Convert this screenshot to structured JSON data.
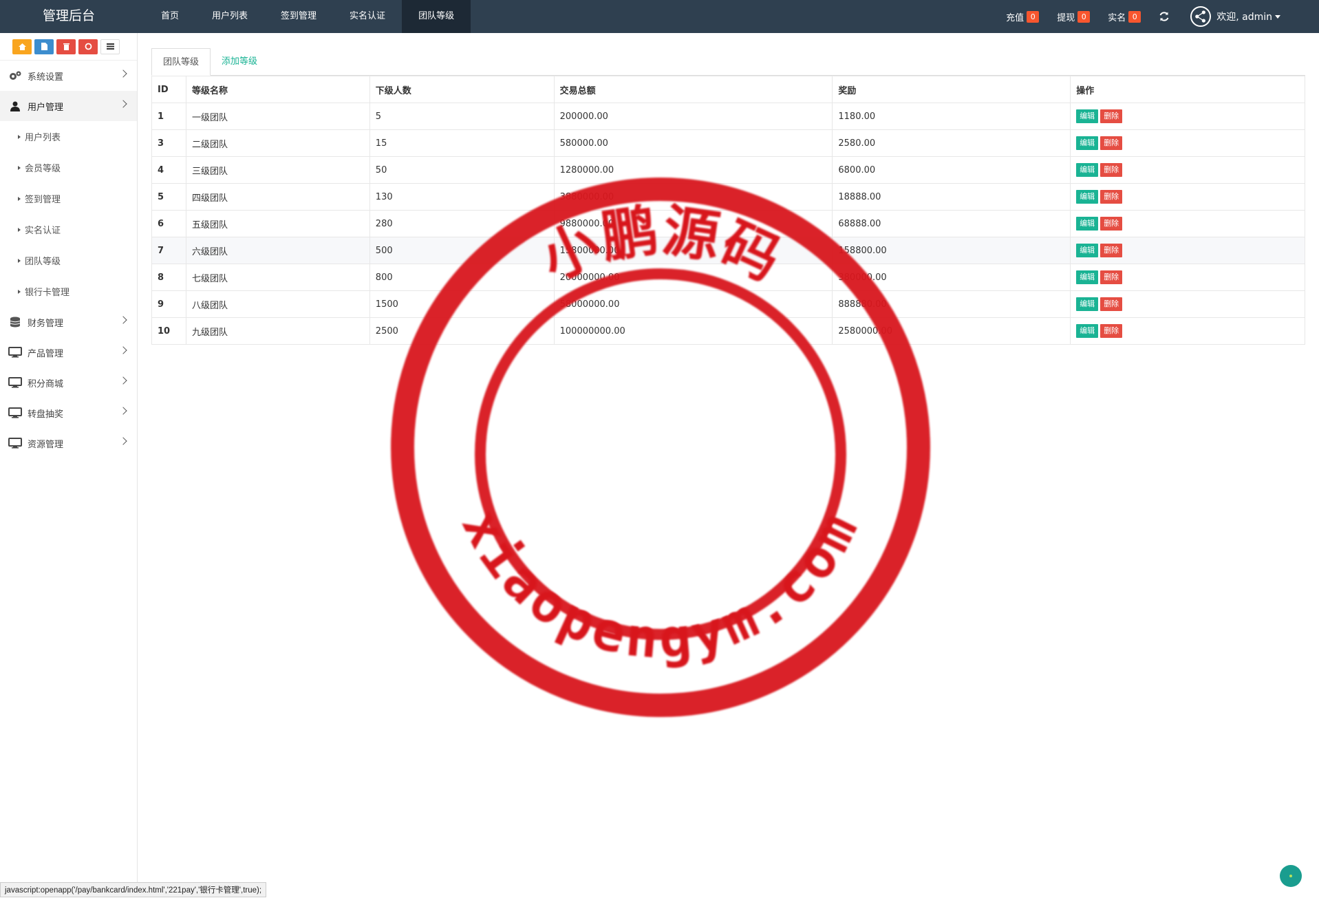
{
  "brand": "管理后台",
  "topnav": [
    "首页",
    "用户列表",
    "签到管理",
    "实名认证",
    "团队等级"
  ],
  "topright": {
    "recharge_label": "充值",
    "recharge_count": "0",
    "withdraw_label": "提现",
    "withdraw_count": "0",
    "realname_label": "实名",
    "realname_count": "0",
    "welcome": "欢迎, admin"
  },
  "sidebar": {
    "menu_system": "系统设置",
    "menu_user": "用户管理",
    "sub_items": [
      "用户列表",
      "会员等级",
      "签到管理",
      "实名认证",
      "团队等级",
      "银行卡管理"
    ],
    "menu_finance": "财务管理",
    "menu_product": "产品管理",
    "menu_points": "积分商城",
    "menu_lottery": "转盘抽奖",
    "menu_resource": "资源管理"
  },
  "tabs": [
    "团队等级",
    "添加等级"
  ],
  "table": {
    "headers": [
      "ID",
      "等级名称",
      "下级人数",
      "交易总额",
      "奖励",
      "操作"
    ],
    "edit_label": "编辑",
    "delete_label": "删除",
    "rows": [
      {
        "id": "1",
        "name": "一级团队",
        "count": "5",
        "total": "200000.00",
        "reward": "1180.00"
      },
      {
        "id": "3",
        "name": "二级团队",
        "count": "15",
        "total": "580000.00",
        "reward": "2580.00"
      },
      {
        "id": "4",
        "name": "三级团队",
        "count": "50",
        "total": "1280000.00",
        "reward": "6800.00"
      },
      {
        "id": "5",
        "name": "四级团队",
        "count": "130",
        "total": "3880000.00",
        "reward": "18888.00"
      },
      {
        "id": "6",
        "name": "五级团队",
        "count": "280",
        "total": "9880000.00",
        "reward": "68888.00"
      },
      {
        "id": "7",
        "name": "六级团队",
        "count": "500",
        "total": "15800000.00",
        "reward": "158800.00"
      },
      {
        "id": "8",
        "name": "七级团队",
        "count": "800",
        "total": "20000000.00",
        "reward": "380000.00"
      },
      {
        "id": "9",
        "name": "八级团队",
        "count": "1500",
        "total": "58000000.00",
        "reward": "888880.00"
      },
      {
        "id": "10",
        "name": "九级团队",
        "count": "2500",
        "total": "100000000.00",
        "reward": "2580000.00"
      }
    ]
  },
  "watermark": {
    "top_text": "小鹏源码",
    "bottom_text": "xiaopengym.com",
    "color": "#d8141a"
  },
  "statusbar": "javascript:openapp('/pay/bankcard/index.html','221pay','银行卡管理',true);"
}
